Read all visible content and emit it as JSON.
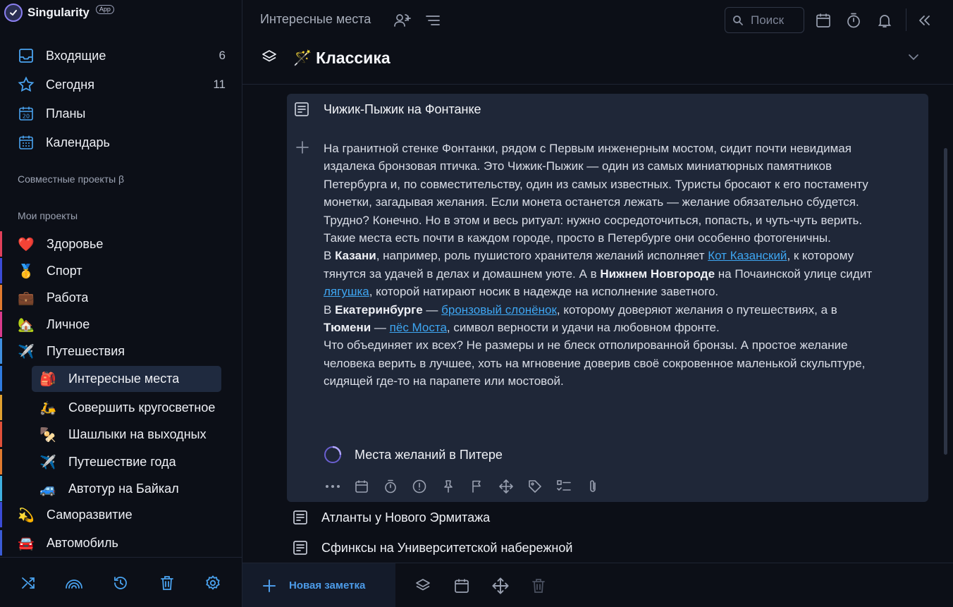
{
  "app": {
    "name": "Singularity",
    "badge": "App"
  },
  "nav": [
    {
      "label": "Входящие",
      "count": "6",
      "icon": "inbox-icon"
    },
    {
      "label": "Сегодня",
      "count": "11",
      "icon": "star-icon"
    },
    {
      "label": "Планы",
      "count": "",
      "icon": "calendar-20-icon"
    },
    {
      "label": "Календарь",
      "count": "",
      "icon": "calendar-grid-icon"
    }
  ],
  "sections": {
    "shared": "Совместные проекты β",
    "mine": "Мои проекты"
  },
  "projects": [
    {
      "label": "Здоровье",
      "emoji": "❤️",
      "color": "#e0405a"
    },
    {
      "label": "Спорт",
      "emoji": "🥇",
      "color": "#3a4bd6"
    },
    {
      "label": "Работа",
      "emoji": "💼",
      "color": "#e07a2f"
    },
    {
      "label": "Личное",
      "emoji": "🏡",
      "color": "#d93a8c"
    },
    {
      "label": "Путешествия",
      "emoji": "✈️",
      "color": "#3f8fe0"
    },
    {
      "label": "Интересные места",
      "emoji": "🎒",
      "color": "#2f7be0"
    },
    {
      "label": "Совершить кругосветное путешествие",
      "emoji": "🛵",
      "color": "#e0a030"
    },
    {
      "label": "Шашлыки на выходных",
      "emoji": "🍢",
      "color": "#e0503a"
    },
    {
      "label": "Путешествие года",
      "emoji": "✈️",
      "color": "#e07a2f"
    },
    {
      "label": "Автотур на Байкал",
      "emoji": "🚙",
      "color": "#3fb0e0"
    },
    {
      "label": "Саморазвитие",
      "emoji": "💫",
      "color": "#3a4bd6"
    },
    {
      "label": "Автомобиль",
      "emoji": "🚘",
      "color": "#3a5bd6"
    }
  ],
  "topbar": {
    "title": "Интересные места",
    "search_placeholder": "Поиск"
  },
  "header": {
    "emoji": "🪄",
    "title": "Классика"
  },
  "card": {
    "title": "Чижик-Пыжик на Фонтанке",
    "p1": "На гранитной стенке Фонтанки, рядом с Первым инженерным мостом, сидит почти невидимая издалека бронзовая птичка. Это Чижик-Пыжик — один из самых миниатюрных памятников Петербурга и, по совместительству, один из самых известных. Туристы бросают к его постаменту монетки, загадывая желания. Если монета останется лежать — желание обязательно сбудется. Трудно? Конечно. Но в этом и весь ритуал: нужно сосредоточиться, попасть, и чуть-чуть верить.",
    "p2": "Такие места есть почти в каждом городе, просто в Петербурге они особенно фотогеничны.",
    "p3_a": "В ",
    "p3_b1": "Казани",
    "p3_c": ", например, роль пушистого хранителя желаний исполняет ",
    "p3_link1": "Кот Казанский",
    "p3_d": ", к которому тянутся за удачей в делах и домашнем уюте. А в ",
    "p3_b2": "Нижнем Новгороде",
    "p3_e": " на Почаинской улице сидит ",
    "p3_link2": "лягушка",
    "p3_f": ", которой натирают носик в надежде на исполнение заветного.",
    "p4_a": "В ",
    "p4_b1": "Екатеринбурге",
    "p4_c": " — ",
    "p4_link1": "бронзовый слонёнок",
    "p4_d": ", которому доверяют желания о путешествиях, а в ",
    "p4_b2": "Тюмени",
    "p4_e": " — ",
    "p4_link2": "пёс Моста",
    "p4_f": ", символ верности и удачи на любовном фронте.",
    "p5": "Что объединяет их всех? Не размеры и не блеск отполированной бронзы. А простое желание человека верить в лучшее, хоть на мгновение доверив своё сокровенное маленькой скульптуре, сидящей где-то на парапете или мостовой.",
    "subtask": "Места желаний в Питере"
  },
  "notes": [
    {
      "title": "Атланты у Нового Эрмитажа"
    },
    {
      "title": "Сфинксы на Университетской набережной"
    }
  ],
  "bottom": {
    "new_note": "Новая заметка"
  }
}
